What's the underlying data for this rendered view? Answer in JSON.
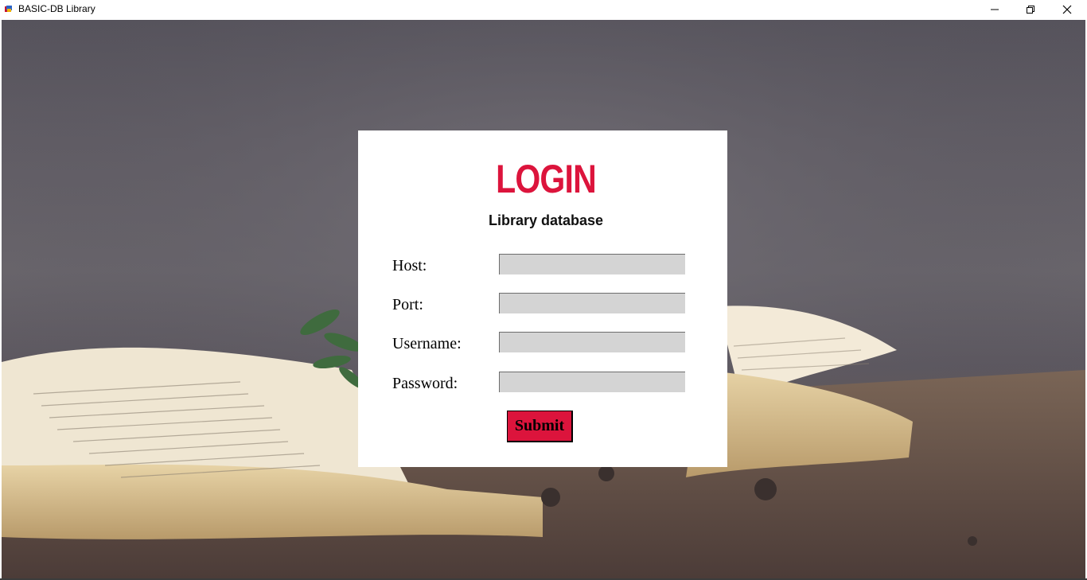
{
  "window": {
    "title": "BASIC-DB Library",
    "icon": "app-icon",
    "controls": {
      "minimize": "minimize-icon",
      "maximize": "restore-icon",
      "close": "close-icon"
    }
  },
  "login": {
    "title": "LOGIN",
    "subtitle": "Library database",
    "fields": [
      {
        "label": "Host:",
        "value": ""
      },
      {
        "label": "Port:",
        "value": ""
      },
      {
        "label": "Username:",
        "value": ""
      },
      {
        "label": "Password:",
        "value": ""
      }
    ],
    "submit_label": "Submit"
  },
  "colors": {
    "accent": "#dc143c",
    "input_bg": "#d4d4d4",
    "panel_bg": "#ffffff"
  }
}
